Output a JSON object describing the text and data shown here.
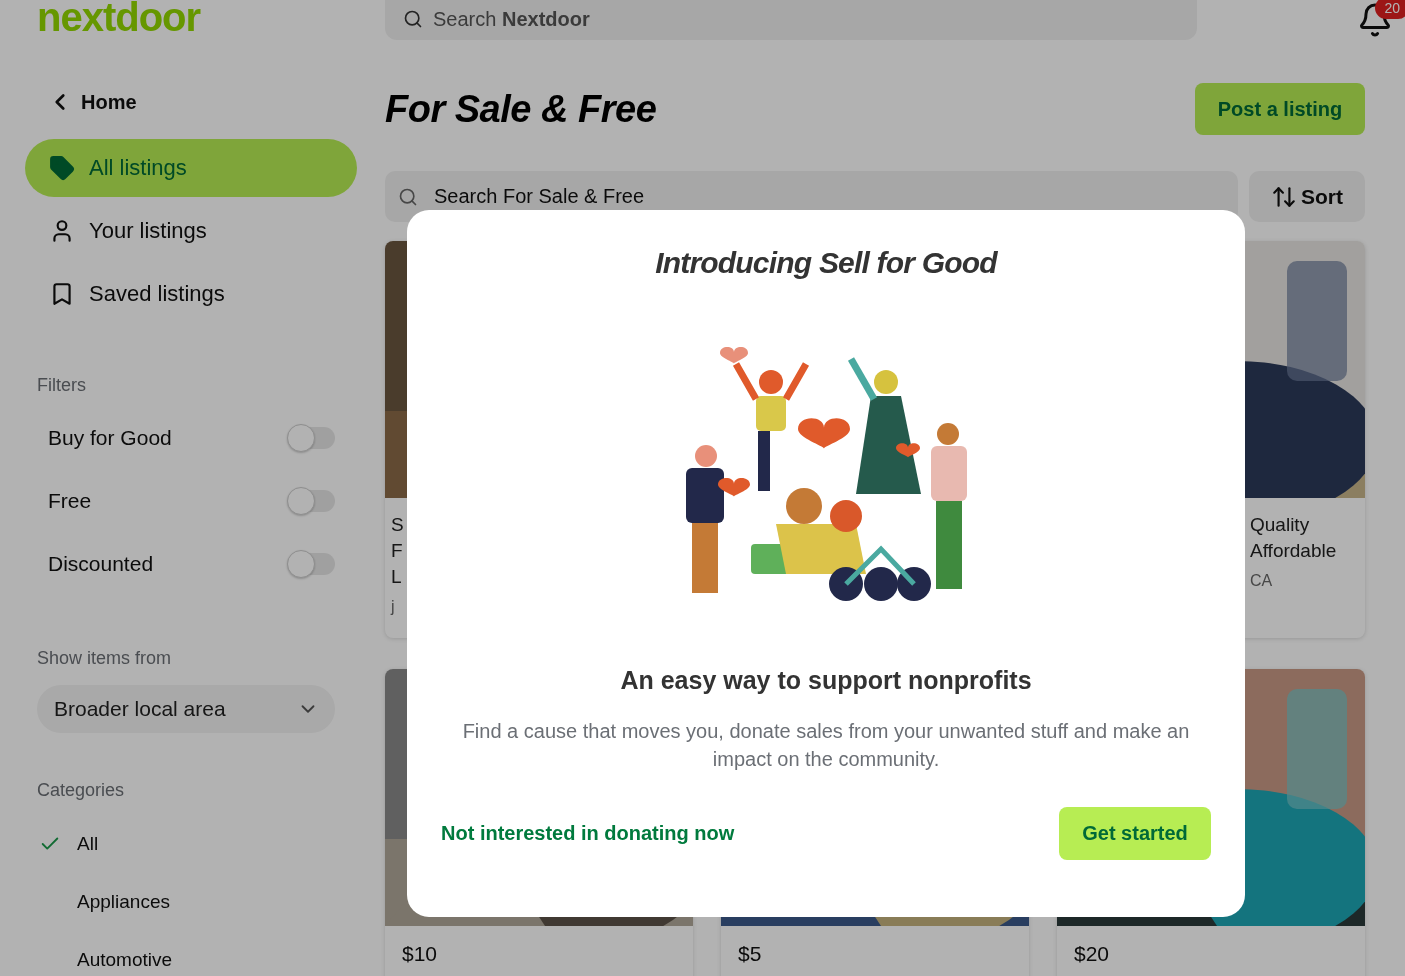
{
  "header": {
    "logo": "nextdoor",
    "search": {
      "placeholder": "Search **Nextdoor**"
    },
    "notifications": {
      "count": "20"
    }
  },
  "sidebar": {
    "back": "Home",
    "nav": [
      {
        "label": "All listings",
        "selected": true
      },
      {
        "label": "Your listings",
        "selected": false
      },
      {
        "label": "Saved listings",
        "selected": false
      }
    ],
    "filters_label": "Filters",
    "filters": [
      {
        "label": "Buy for Good",
        "on": false
      },
      {
        "label": "Free",
        "on": false
      },
      {
        "label": "Discounted",
        "on": false
      }
    ],
    "show_items_label": "Show items from",
    "location": {
      "value": "Broader local area"
    },
    "categories_label": "Categories",
    "categories": [
      {
        "label": "All",
        "selected": true
      },
      {
        "label": "Appliances",
        "selected": false
      },
      {
        "label": "Automotive",
        "selected": false
      }
    ]
  },
  "main": {
    "title": "For Sale & Free",
    "post_button": "Post a listing",
    "search": {
      "placeholder": "Search For Sale & Free"
    },
    "sort": "Sort",
    "listings": [
      {
        "kind": "text",
        "lines": [
          "S",
          "F",
          "L"
        ],
        "location": "j"
      },
      {
        "kind": "text",
        "lines": [
          "Quality",
          "Affordable"
        ],
        "location": "CA"
      },
      {
        "kind": "price",
        "price": "$10"
      },
      {
        "kind": "price",
        "price": "$5"
      },
      {
        "kind": "price",
        "price": "$20"
      }
    ]
  },
  "modal": {
    "title": "Introducing Sell for Good",
    "heading": "An easy way to support nonprofits",
    "body": "Find a cause that moves you, donate sales from your unwanted stuff and make an impact on the community.",
    "dismiss": "Not interested in donating now",
    "cta": "Get started"
  }
}
